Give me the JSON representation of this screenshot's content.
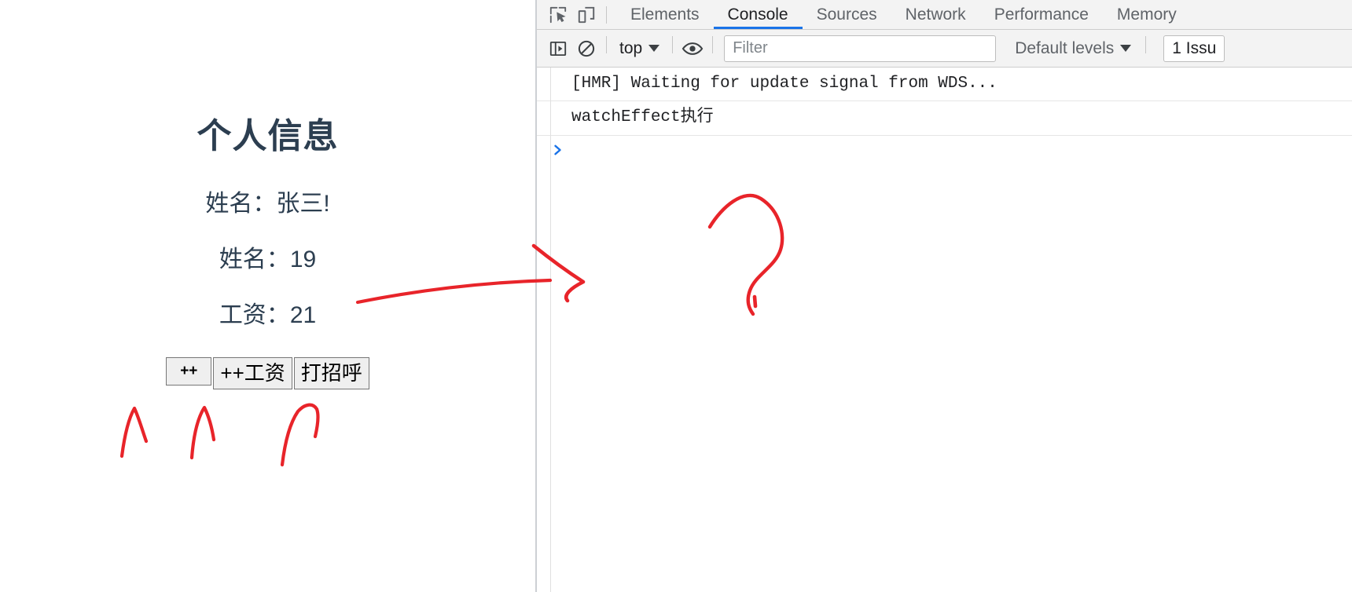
{
  "page": {
    "title": "个人信息",
    "rows": [
      {
        "label": "姓名：",
        "value": "张三!"
      },
      {
        "label": "姓名：",
        "value": "19"
      },
      {
        "label": "工资：",
        "value": "21"
      }
    ],
    "buttons": [
      {
        "label": "++",
        "name": "increment-button"
      },
      {
        "label": "++工资",
        "name": "increment-salary-button"
      },
      {
        "label": "打招呼",
        "name": "greet-button"
      }
    ],
    "colors": {
      "text": "#2c3e50",
      "button_bg": "#efefef",
      "button_border": "#767676"
    }
  },
  "devtools": {
    "icons": {
      "inspect": "inspect-element-icon",
      "device": "device-toolbar-icon",
      "sidebar": "console-sidebar-icon",
      "clear": "clear-console-icon",
      "eye": "live-expression-eye-icon"
    },
    "tabs": [
      {
        "label": "Elements",
        "active": false
      },
      {
        "label": "Console",
        "active": true
      },
      {
        "label": "Sources",
        "active": false
      },
      {
        "label": "Network",
        "active": false
      },
      {
        "label": "Performance",
        "active": false
      },
      {
        "label": "Memory",
        "active": false
      }
    ],
    "toolbar": {
      "context": "top",
      "filter_placeholder": "Filter",
      "filter_value": "",
      "levels": "Default levels",
      "issues": "1 Issu"
    },
    "console": {
      "messages": [
        "[HMR] Waiting for update signal from WDS...",
        "watchEffect执行"
      ],
      "prompt": "❯"
    },
    "colors": {
      "accent": "#1a73e8",
      "toolbar_bg": "#f3f3f3",
      "border": "#cdcdcd"
    }
  },
  "annotations": {
    "color": "#e8242a",
    "marks": [
      {
        "name": "arrow-to-console",
        "kind": "long-right-arrow"
      },
      {
        "name": "question-mark",
        "kind": "question-mark"
      },
      {
        "name": "arrow-up-increment",
        "kind": "up-arrow"
      },
      {
        "name": "arrow-up-increment-salary",
        "kind": "up-arrow"
      },
      {
        "name": "arrow-up-greet",
        "kind": "up-arrow"
      }
    ]
  }
}
